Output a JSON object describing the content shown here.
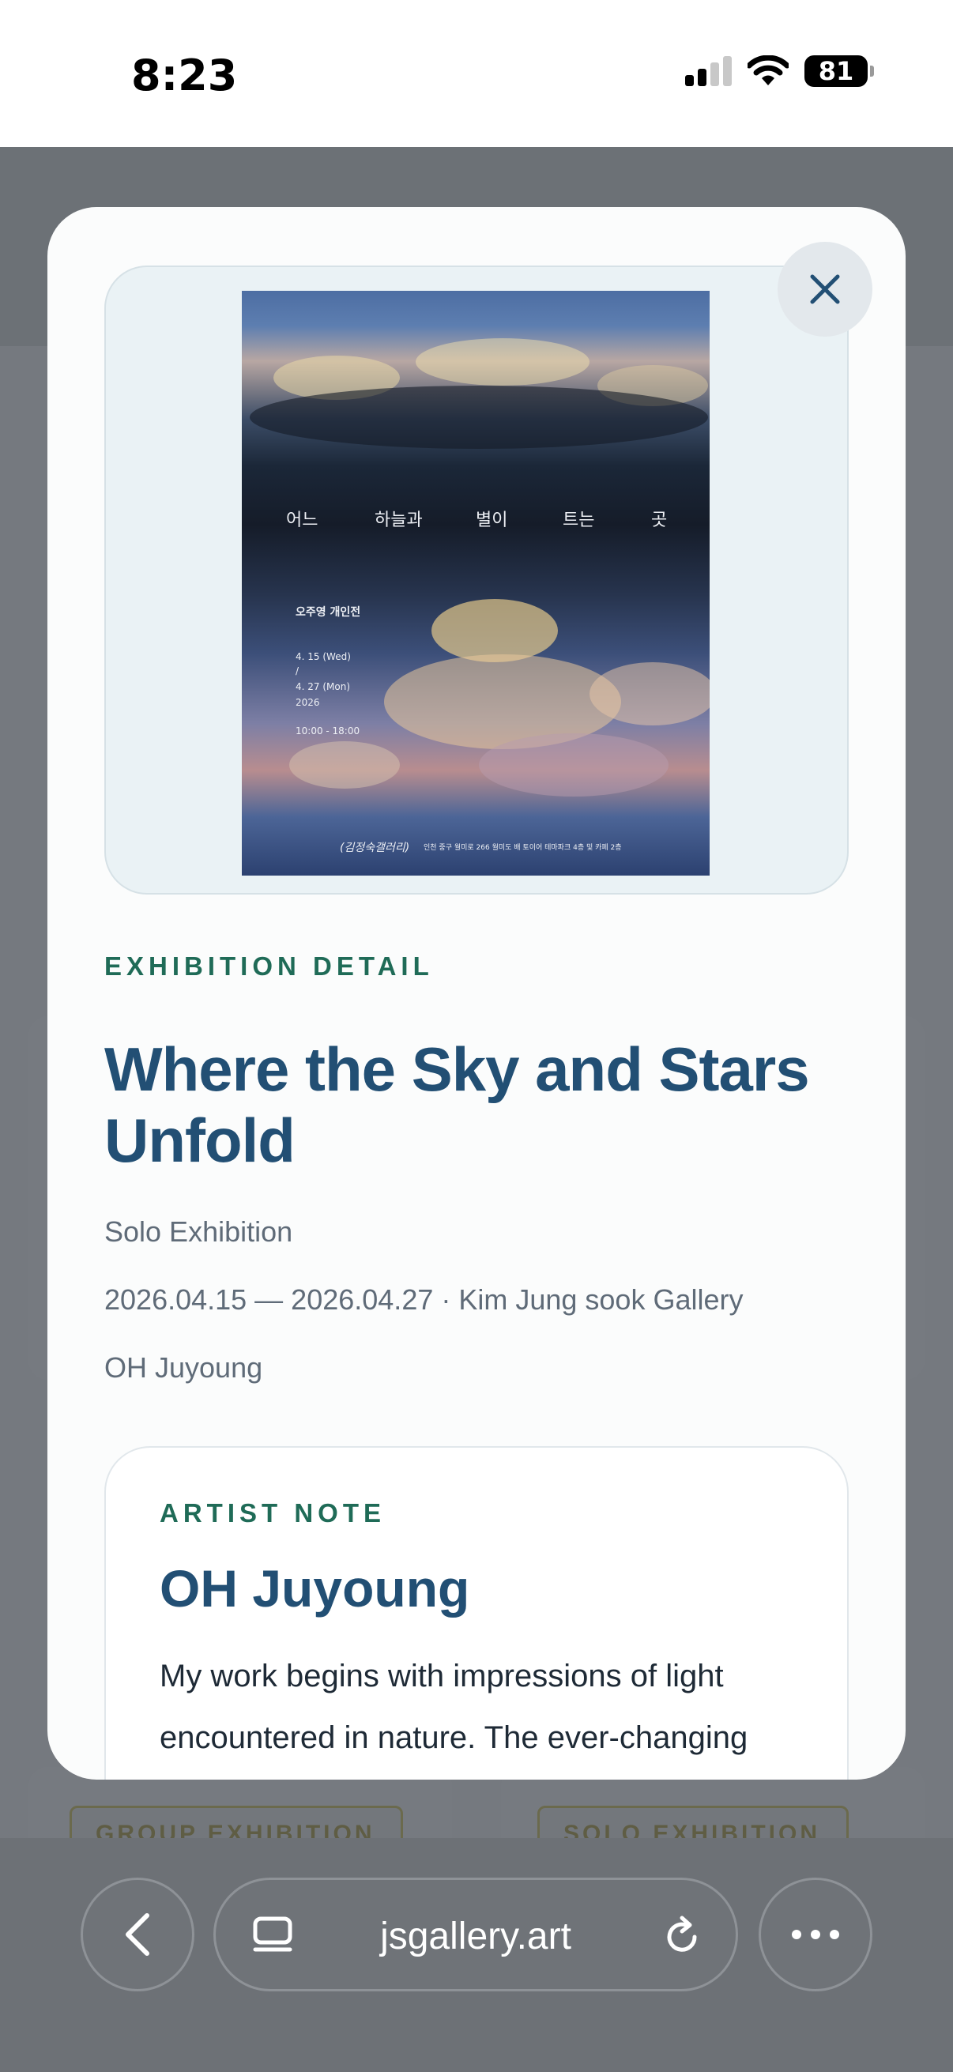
{
  "status_bar": {
    "time": "8:23",
    "battery": "81"
  },
  "background_page": {
    "badge_left": "GROUP EXHIBITION",
    "badge_right": "SOLO EXHIBITION"
  },
  "modal": {
    "poster": {
      "title_words": [
        "어느",
        "하늘과",
        "별이",
        "트는",
        "곳"
      ],
      "subtitle": "오주영 개인전",
      "date_lines": [
        "4. 15 (Wed)",
        "/",
        "4. 27 (Mon)",
        "2026"
      ],
      "hours": "10:00 - 18:00",
      "footer_logo": "(김정숙갤러리)",
      "footer_address": "인천 중구 월미로 266 월미도 배 토이어 테마파크 4층 및 카페 2층"
    },
    "eyebrow": "EXHIBITION DETAIL",
    "title": "Where the Sky and Stars Unfold",
    "type": "Solo Exhibition",
    "dates_venue": "2026.04.15 — 2026.04.27 · Kim Jung sook Gallery",
    "artist": "OH Juyoung",
    "artist_note": {
      "eyebrow": "ARTIST NOTE",
      "name": "OH Juyoung",
      "text": "My work begins with impressions of light encountered in nature. The ever-changing"
    }
  },
  "browser": {
    "url": "jsgallery.art"
  },
  "colors": {
    "accent_green": "#1f6b57",
    "title_blue": "#224f74",
    "scrim": "#6f7378"
  }
}
